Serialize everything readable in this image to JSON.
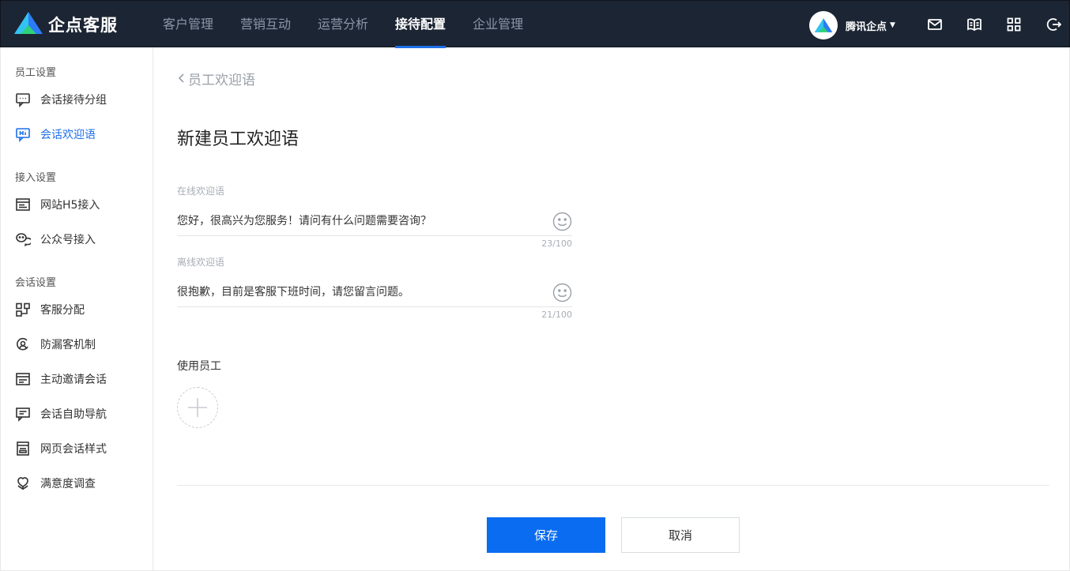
{
  "brand": {
    "name": "企点客服",
    "logo_icon": "qidian-logo-icon"
  },
  "nav": [
    {
      "label": "客户管理",
      "active": false
    },
    {
      "label": "营销互动",
      "active": false
    },
    {
      "label": "运营分析",
      "active": false
    },
    {
      "label": "接待配置",
      "active": true
    },
    {
      "label": "企业管理",
      "active": false
    }
  ],
  "user": {
    "name": "腾讯企点"
  },
  "header_icons": [
    "mail-icon",
    "book-icon",
    "grid-apps-icon",
    "logout-icon"
  ],
  "sidebar": {
    "sections": [
      {
        "title": "员工设置",
        "items": [
          {
            "label": "会话接待分组",
            "icon": "chat-group-icon",
            "active": false
          },
          {
            "label": "会话欢迎语",
            "icon": "hi-message-icon",
            "active": true
          }
        ]
      },
      {
        "title": "接入设置",
        "items": [
          {
            "label": "网站H5接入",
            "icon": "website-icon",
            "active": false
          },
          {
            "label": "公众号接入",
            "icon": "wechat-icon",
            "active": false
          }
        ]
      },
      {
        "title": "会话设置",
        "items": [
          {
            "label": "客服分配",
            "icon": "distribute-icon",
            "active": false
          },
          {
            "label": "防漏客机制",
            "icon": "anti-miss-icon",
            "active": false
          },
          {
            "label": "主动邀请会话",
            "icon": "invite-icon",
            "active": false
          },
          {
            "label": "会话自助导航",
            "icon": "nav-guide-icon",
            "active": false
          },
          {
            "label": "网页会话样式",
            "icon": "page-style-icon",
            "active": false
          },
          {
            "label": "满意度调查",
            "icon": "satisfaction-icon",
            "active": false
          }
        ]
      }
    ]
  },
  "main": {
    "back_label": "员工欢迎语",
    "title": "新建员工欢迎语",
    "online": {
      "label": "在线欢迎语",
      "value": "您好，很高兴为您服务！请问有什么问题需要咨询？",
      "counter": "23/100"
    },
    "offline": {
      "label": "离线欢迎语",
      "value": "很抱歉，目前是客服下班时间，请您留言问题。",
      "counter": "21/100"
    },
    "staff_label": "使用员工",
    "save_label": "保存",
    "cancel_label": "取消"
  },
  "colors": {
    "topbar": "#1c2534",
    "accent": "#1e6fe8",
    "primary_button": "#0a6cf0"
  }
}
